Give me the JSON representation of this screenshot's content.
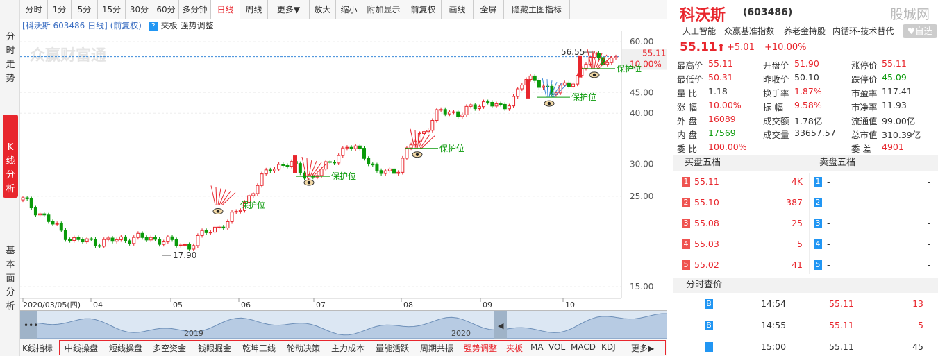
{
  "sidebar": {
    "tabs": [
      "分\n时\n走\n势",
      "K\n线\n分\n析",
      "基\n本\n面\n分\n析"
    ]
  },
  "toolbar": {
    "items": [
      "分时",
      "1分",
      "5分",
      "15分",
      "30分",
      "60分",
      "多分钟",
      "日线",
      "周线",
      "更多▼",
      "放大",
      "缩小",
      "附加显示",
      "前复权",
      "画线",
      "全屏",
      "隐藏主图指标"
    ],
    "active": "日线"
  },
  "chart": {
    "title": "[科沃斯 603486 日线] (前复权)",
    "toggle_label": "?",
    "indicator_labels": [
      "夹板",
      "强势调整"
    ],
    "watermark": "众赢财富通",
    "price_ticks": [
      "60.00",
      "45.00",
      "40.00",
      "30.00",
      "25.00",
      "15.00"
    ],
    "current_price_tag": "55.11",
    "current_pct_tag": "10.00%",
    "high_label": "56.55",
    "low_label": "17.90",
    "protect_label": "保护位",
    "date_labels": [
      "2020/03/05(四)",
      "04",
      "05",
      "06",
      "07",
      "08",
      "09",
      "10"
    ],
    "nav_years": [
      "2019",
      "2020"
    ]
  },
  "indicators": {
    "items": [
      "K线指标",
      "中线操盘",
      "短线操盘",
      "多空资金",
      "钱眼掘金",
      "乾坤三线",
      "轮动决策",
      "主力成本",
      "量能活跃",
      "周期共振",
      "强势调整",
      "夹板",
      "MA",
      "VOL",
      "MACD",
      "KDJ",
      "更多▶"
    ]
  },
  "quote": {
    "name": "科沃斯",
    "code": "(603486)",
    "site": "股城网",
    "tags": [
      "人工智能",
      "众赢基准指数",
      "养老金持股",
      "内循环-技术替代"
    ],
    "watch_label": "♥自选",
    "price": "55.11",
    "arrow": "⬆",
    "change": "+5.01",
    "pct": "+10.00%",
    "rows": [
      [
        [
          "最高价",
          "55.11",
          "r"
        ],
        [
          "开盘价",
          "51.90",
          "r"
        ],
        [
          "涨停价",
          "55.11",
          "r"
        ]
      ],
      [
        [
          "最低价",
          "50.31",
          "r"
        ],
        [
          "昨收价",
          "50.10",
          "k"
        ],
        [
          "跌停价",
          "45.09",
          "g"
        ]
      ],
      [
        [
          "量  比",
          "1.18",
          "k"
        ],
        [
          "换手率",
          "1.87%",
          "r"
        ],
        [
          "市盈率",
          "117.41",
          "k"
        ]
      ],
      [
        [
          "涨  幅",
          "10.00%",
          "r"
        ],
        [
          "振  幅",
          "9.58%",
          "r"
        ],
        [
          "市净率",
          "11.93",
          "k"
        ]
      ],
      [
        [
          "外  盘",
          "16089",
          "r"
        ],
        [
          "成交额",
          "1.78亿",
          "k"
        ],
        [
          "流通值",
          "99.00亿",
          "k"
        ]
      ],
      [
        [
          "内  盘",
          "17569",
          "g"
        ],
        [
          "成交量",
          "33657.57",
          "k"
        ],
        [
          "总市值",
          "310.39亿",
          "k"
        ]
      ],
      [
        [
          "委  比",
          "100.00%",
          "r"
        ],
        [
          "",
          "",
          " "
        ],
        [
          "委  差",
          "4901",
          "r"
        ]
      ]
    ],
    "buy_title": "买盘五档",
    "sell_title": "卖盘五档",
    "buy": [
      [
        "1",
        "55.11",
        "4K"
      ],
      [
        "2",
        "55.10",
        "387"
      ],
      [
        "3",
        "55.08",
        "25"
      ],
      [
        "4",
        "55.03",
        "5"
      ],
      [
        "5",
        "55.02",
        "41"
      ]
    ],
    "sell": [
      [
        "1",
        "-",
        "-"
      ],
      [
        "2",
        "-",
        "-"
      ],
      [
        "3",
        "-",
        "-"
      ],
      [
        "4",
        "-",
        "-"
      ],
      [
        "5",
        "-",
        "-"
      ]
    ],
    "ticks_title": "分时查价",
    "ticks": [
      [
        "B",
        "14:54",
        "55.11",
        "13"
      ],
      [
        "B",
        "14:55",
        "55.11",
        "5"
      ],
      [
        "",
        "15:00",
        "55.11",
        "45"
      ]
    ]
  },
  "colors": {
    "up": "#e8262d",
    "down": "#0a9a0a",
    "accent": "#e8262d",
    "blue": "#2196f3"
  }
}
